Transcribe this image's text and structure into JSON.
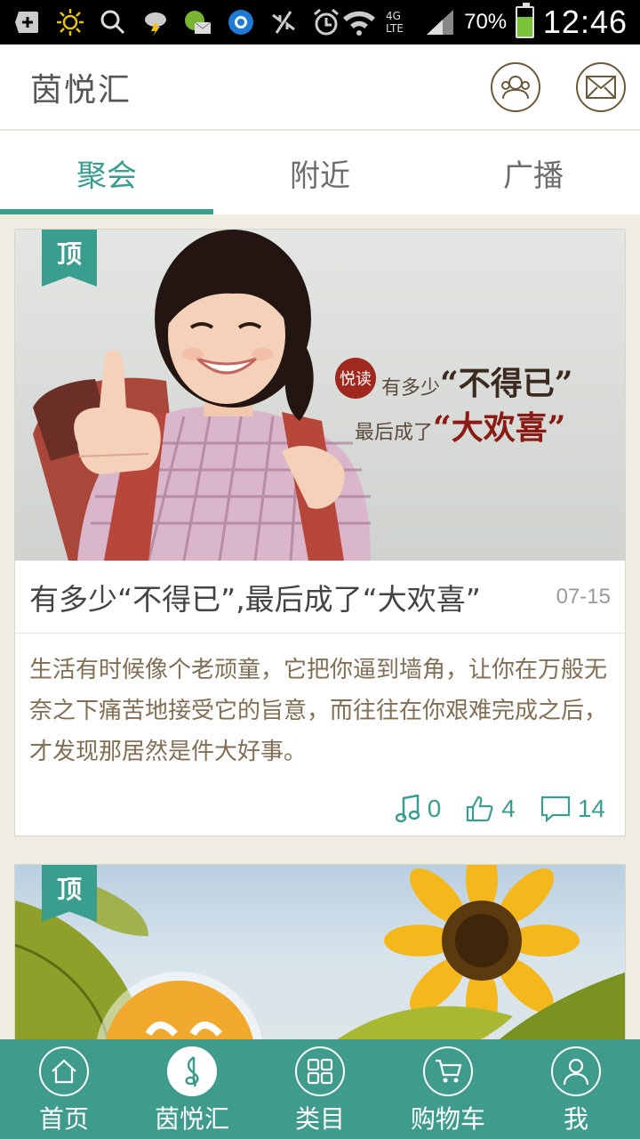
{
  "status_bar": {
    "battery": "70%",
    "battery_level": 0.7,
    "network": "4G LTE",
    "time": "12:46"
  },
  "app": {
    "title": "茵悦汇"
  },
  "tabs": [
    {
      "label": "聚会",
      "active": true
    },
    {
      "label": "附近",
      "active": false
    },
    {
      "label": "广播",
      "active": false
    }
  ],
  "posts": [
    {
      "pinned_label": "顶",
      "image_text": {
        "seal": "悦读",
        "line1_prefix": "有多少",
        "line1_emphasis": "“不得已”",
        "line2_prefix": "最后成了",
        "line2_emphasis": "“大欢喜”"
      },
      "title": "有多少“不得已”,最后成了“大欢喜”",
      "date": "07-15",
      "body": "生活有时候像个老顽童，它把你逼到墙角，让你在万般无奈之下痛苦地接受它的旨意，而往往在你艰难完成之后，才发现那居然是件大好事。",
      "stats": {
        "music": "0",
        "likes": "4",
        "comments": "14"
      }
    },
    {
      "pinned_label": "顶"
    }
  ],
  "bottom_nav": [
    {
      "label": "首页",
      "icon": "home-icon",
      "active": false
    },
    {
      "label": "茵悦汇",
      "icon": "music-note-icon",
      "active": true
    },
    {
      "label": "类目",
      "icon": "grid-icon",
      "active": false
    },
    {
      "label": "购物车",
      "icon": "cart-icon",
      "active": false
    },
    {
      "label": "我",
      "icon": "user-icon",
      "active": false
    }
  ],
  "colors": {
    "accent": "#3a9e8e",
    "nav_bg": "#3f9c8c",
    "body_text": "#806f55"
  }
}
